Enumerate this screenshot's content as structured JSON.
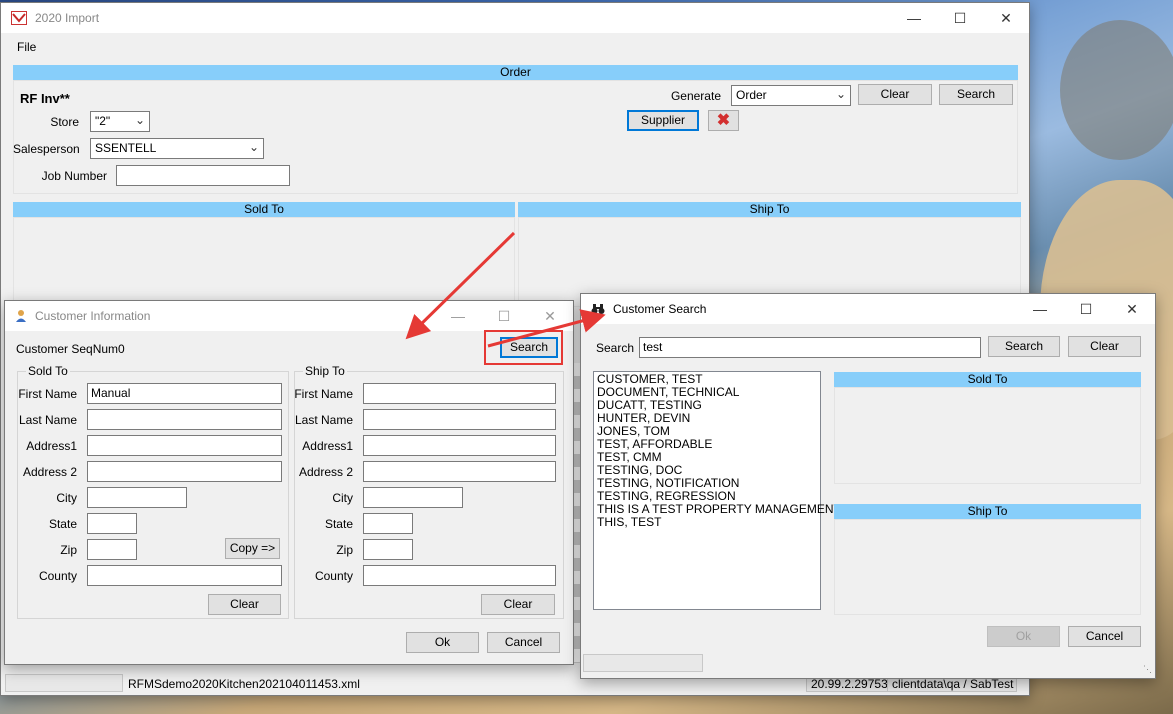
{
  "main": {
    "title": "2020 Import",
    "menu_file": "File",
    "order_band": "Order",
    "rf_inv": "RF Inv**",
    "store_label": "Store",
    "store_value": "\"2\"",
    "salesperson_label": "Salesperson",
    "salesperson_value": "SSENTELL",
    "job_number_label": "Job Number",
    "job_number_value": "",
    "generate_label": "Generate",
    "generate_value": "Order",
    "clear_btn": "Clear",
    "search_btn": "Search",
    "supplier_btn": "Supplier",
    "sold_to_band": "Sold To",
    "ship_to_band": "Ship To",
    "status_file": "RFMSdemo2020Kitchen202104011453.xml",
    "status_version": "20.99.2.29753",
    "status_path": "clientdata\\qa / SabTest"
  },
  "customer_info": {
    "title": "Customer Information",
    "seqnum_label": "Customer SeqNum",
    "seqnum_value": "0",
    "search_btn": "Search",
    "sold_to": {
      "title": "Sold To",
      "first_name_label": "First Name",
      "first_name_value": "Manual",
      "last_name_label": "Last Name",
      "address1_label": "Address1",
      "address2_label": "Address 2",
      "city_label": "City",
      "state_label": "State",
      "zip_label": "Zip",
      "county_label": "County",
      "copy_btn": "Copy =>",
      "clear_btn": "Clear"
    },
    "ship_to": {
      "title": "Ship To",
      "first_name_label": "First Name",
      "last_name_label": "Last Name",
      "address1_label": "Address1",
      "address2_label": "Address 2",
      "city_label": "City",
      "state_label": "State",
      "zip_label": "Zip",
      "county_label": "County",
      "clear_btn": "Clear"
    },
    "ok_btn": "Ok",
    "cancel_btn": "Cancel"
  },
  "customer_search": {
    "title": "Customer Search",
    "search_label": "Search",
    "search_value": "test",
    "search_btn": "Search",
    "clear_btn": "Clear",
    "results": [
      "CUSTOMER, TEST",
      "DOCUMENT, TECHNICAL",
      "DUCATT, TESTING",
      "HUNTER, DEVIN",
      "JONES, TOM",
      "TEST, AFFORDABLE",
      "TEST, CMM",
      "TESTING, DOC",
      "TESTING, NOTIFICATION",
      "TESTING, REGRESSION",
      "THIS IS A TEST PROPERTY MANAGEMENT",
      "THIS, TEST"
    ],
    "sold_to_band": "Sold To",
    "ship_to_band": "Ship To",
    "ok_btn": "Ok",
    "cancel_btn": "Cancel"
  },
  "colors": {
    "band": "#87cefa",
    "annotation": "#e53935",
    "focus": "#0078d7"
  },
  "icons": {
    "app": "app-logo-icon",
    "customer": "person-icon",
    "search_window": "binoculars-icon",
    "delete": "red-x-icon"
  }
}
